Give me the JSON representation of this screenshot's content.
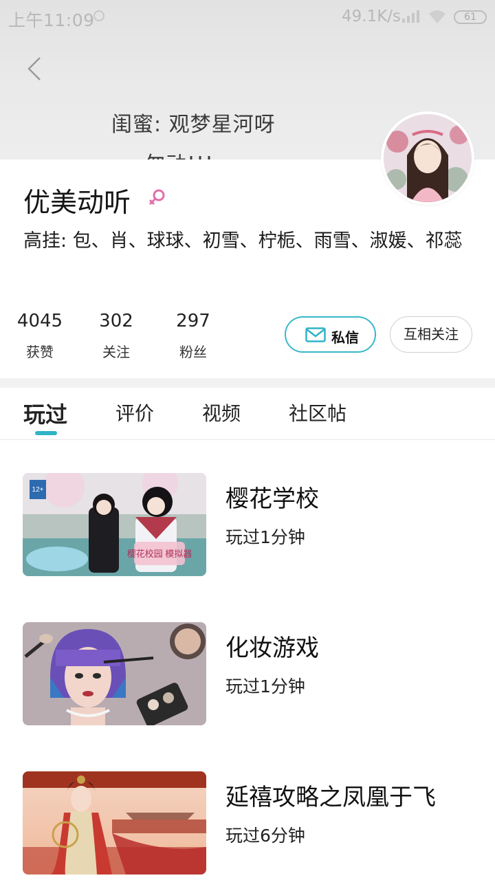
{
  "status_bar": {
    "time": "上午11:09",
    "network_speed": "49.1K/s",
    "battery": "61"
  },
  "banner": {
    "line1": "闺蜜: 观梦星河呀",
    "line2": "勿动!!!"
  },
  "profile": {
    "username": "优美动听",
    "gender": "female",
    "bio": "高挂: 包、肖、球球、初雪、柠栀、雨雪、淑媛、祁蕊",
    "stats": [
      {
        "value": "4045",
        "label": "获赞"
      },
      {
        "value": "302",
        "label": "关注"
      },
      {
        "value": "297",
        "label": "粉丝"
      }
    ],
    "message_label": "私信",
    "follow_label": "互相关注"
  },
  "tabs": [
    {
      "label": "玩过",
      "active": true
    },
    {
      "label": "评价",
      "active": false
    },
    {
      "label": "视频",
      "active": false
    },
    {
      "label": "社区帖",
      "active": false
    }
  ],
  "games": [
    {
      "title": "樱花学校",
      "played": "玩过1分钟",
      "age_badge": "12+",
      "logo_text": "樱花校园 模拟器"
    },
    {
      "title": "化妆游戏",
      "played": "玩过1分钟"
    },
    {
      "title": "延禧攻略之凤凰于飞",
      "played": "玩过6分钟"
    }
  ],
  "colors": {
    "accent": "#2fb3c6",
    "gender_pink": "#e06fa8"
  }
}
